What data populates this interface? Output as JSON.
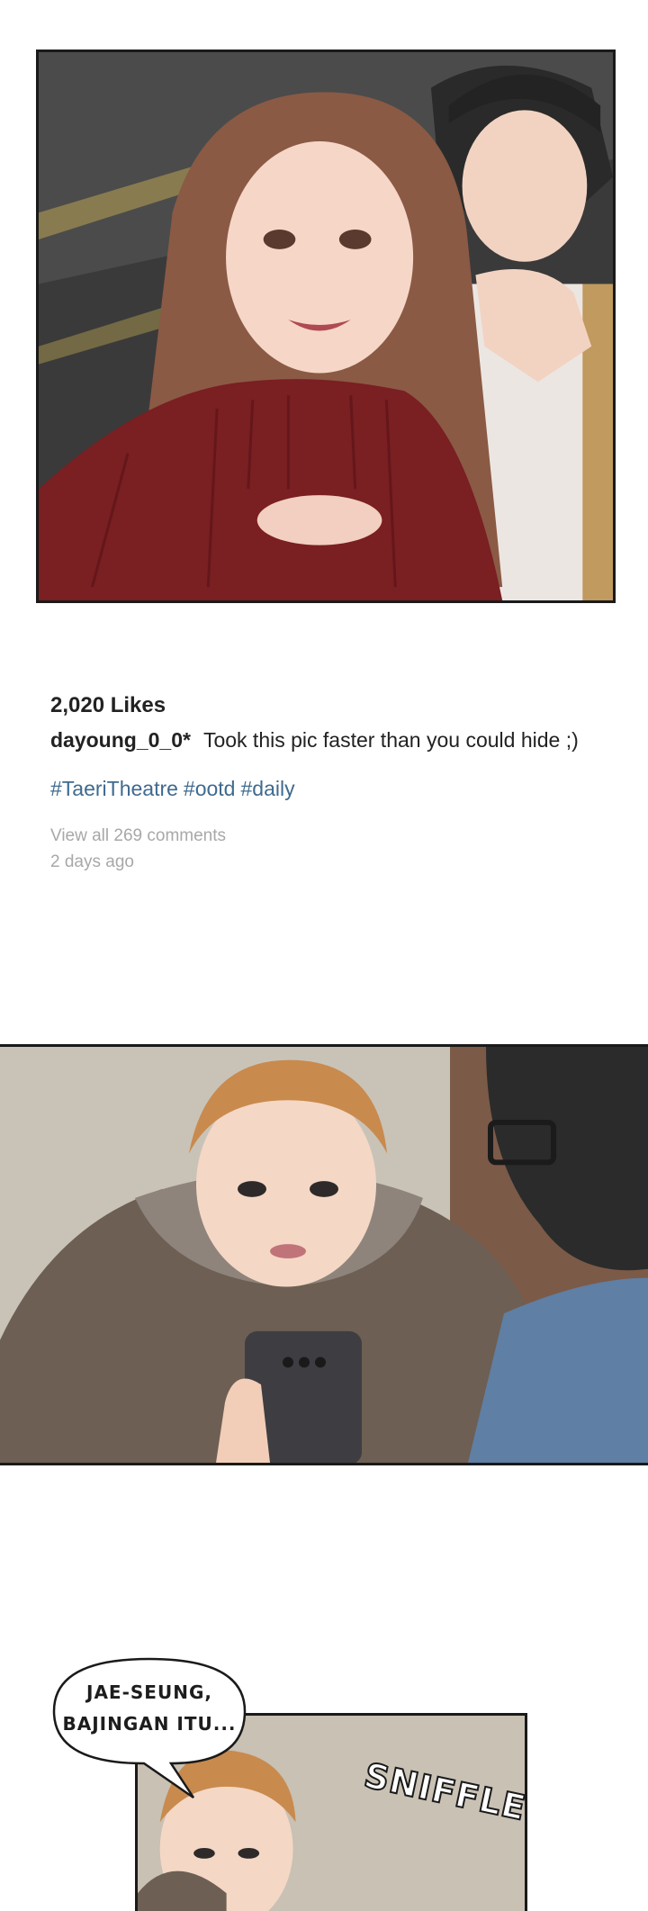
{
  "post": {
    "likes": "2,020 Likes",
    "username": "dayoung_0_0*",
    "caption": "Took this pic faster than you could hide ;)",
    "hashtags": [
      "#TaeriTheatre",
      "#ootd",
      "#daily"
    ],
    "view_comments": "View all 269 comments",
    "timestamp": "2 days ago"
  },
  "speech_bubble": {
    "line1": "JAE-SEUNG,",
    "line2": "BAJINGAN ITU..."
  },
  "sfx": "SNIFFLE",
  "colors": {
    "hashtag": "#3f6a8f",
    "meta_gray": "#a8a8a8",
    "sweater_red": "#7a1f22",
    "panel_border": "#1a1a1a"
  }
}
